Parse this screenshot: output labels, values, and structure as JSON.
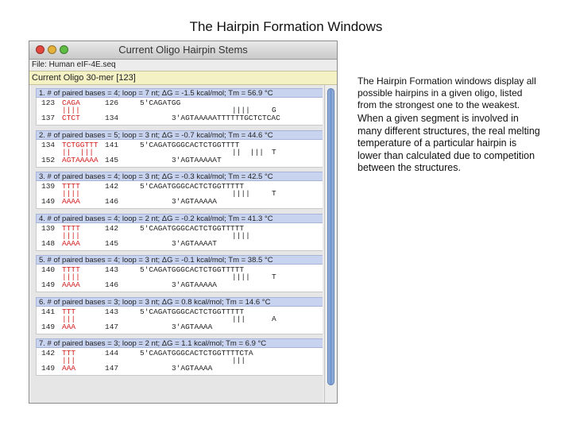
{
  "slide": {
    "title": "The Hairpin Formation Windows",
    "description_1": "The Hairpin Formation windows display all possible hairpins in a given oligo, listed from the strongest one to the weakest.",
    "description_2": "When a given segment is involved in many different structures, the real melting temperature of a particular hairpin is lower than calculated due to competition between the structures."
  },
  "window": {
    "title": "Current Oligo Hairpin Stems",
    "file_label": "File: Human eIF-4E.seq",
    "oligo_label": "Current Oligo 30-mer [123]"
  },
  "hairpins": [
    {
      "header": "1. # of paired bases = 4; loop = 7 nt; ΔG = -1.5 kcal/mol; Tm = 56.9 °C",
      "top_left": "123",
      "top_red": "CAGA",
      "top_right": "126",
      "bars": "||||",
      "bot_left": "137",
      "bot_red": "CTCT",
      "bot_right": "134",
      "seq_top": "5'CAGATGG",
      "seq_bars": "||||",
      "seq_bot": "3'AGTAAAAATTTTTTGCTCTCAC",
      "loop_char": "G"
    },
    {
      "header": "2. # of paired bases = 5; loop = 3 nt; ΔG = -0.7 kcal/mol; Tm = 44.6 °C",
      "top_left": "134",
      "top_red": "TCTGGTTT",
      "top_right": "141",
      "bars": "||  |||",
      "bot_left": "152",
      "bot_red": "AGTAAAAA",
      "bot_right": "145",
      "seq_top": "5'CAGATGGGCACTCTGGTTTT",
      "seq_bars": "||  |||",
      "seq_bot": "3'AGTAAAAAT",
      "loop_char": "T"
    },
    {
      "header": "3. # of paired bases = 4; loop = 3 nt; ΔG = -0.3 kcal/mol; Tm = 42.5 °C",
      "top_left": "139",
      "top_red": "TTTT",
      "top_right": "142",
      "bars": "||||",
      "bot_left": "149",
      "bot_red": "AAAA",
      "bot_right": "146",
      "seq_top": "5'CAGATGGGCACTCTGGTTTTT",
      "seq_bars": "||||",
      "seq_bot": "3'AGTAAAAA",
      "loop_char": "T"
    },
    {
      "header": "4. # of paired bases = 4; loop = 2 nt; ΔG = -0.2 kcal/mol; Tm = 41.3 °C",
      "top_left": "139",
      "top_red": "TTTT",
      "top_right": "142",
      "bars": "||||",
      "bot_left": "148",
      "bot_red": "AAAA",
      "bot_right": "145",
      "seq_top": "5'CAGATGGGCACTCTGGTTTTT",
      "seq_bars": "||||",
      "seq_bot": "3'AGTAAAAT",
      "loop_char": ""
    },
    {
      "header": "5. # of paired bases = 4; loop = 3 nt; ΔG = -0.1 kcal/mol; Tm = 38.5 °C",
      "top_left": "140",
      "top_red": "TTTT",
      "top_right": "143",
      "bars": "||||",
      "bot_left": "149",
      "bot_red": "AAAA",
      "bot_right": "146",
      "seq_top": "5'CAGATGGGCACTCTGGTTTTT",
      "seq_bars": "||||",
      "seq_bot": "3'AGTAAAAA",
      "loop_char": "T"
    },
    {
      "header": "6. # of paired bases = 3; loop = 3 nt; ΔG = 0.8 kcal/mol; Tm = 14.6 °C",
      "top_left": "141",
      "top_red": "TTT",
      "top_right": "143",
      "bars": "|||",
      "bot_left": "149",
      "bot_red": "AAA",
      "bot_right": "147",
      "seq_top": "5'CAGATGGGCACTCTGGTTTTT",
      "seq_bars": "|||",
      "seq_bot": "3'AGTAAAA",
      "loop_char": "A"
    },
    {
      "header": "7. # of paired bases = 3; loop = 2 nt; ΔG = 1.1 kcal/mol; Tm = 6.9 °C",
      "top_left": "142",
      "top_red": "TTT",
      "top_right": "144",
      "bars": "|||",
      "bot_left": "149",
      "bot_red": "AAA",
      "bot_right": "147",
      "seq_top": "5'CAGATGGGCACTCTGGTTTTCTA",
      "seq_bars": "|||",
      "seq_bot": "3'AGTAAAA",
      "loop_char": ""
    }
  ],
  "colors": {
    "accent": "#d11b1b",
    "header_bg": "#c7d3ef",
    "oligo_bar": "#f4f1c4"
  }
}
